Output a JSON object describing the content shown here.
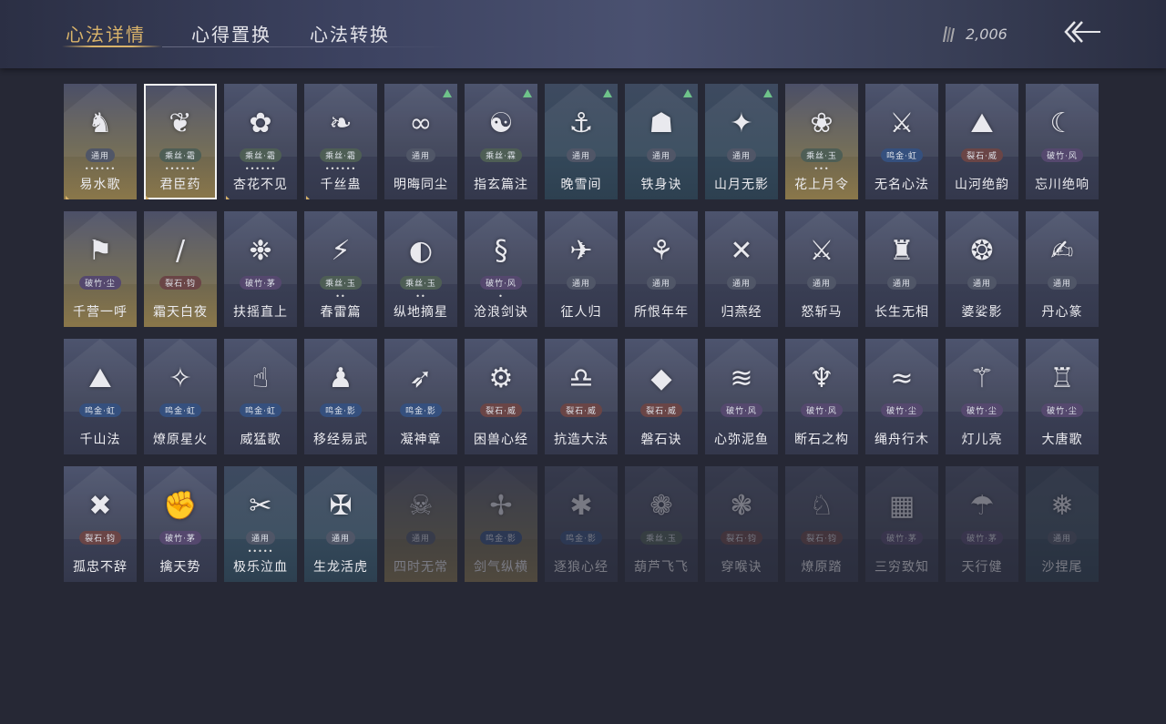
{
  "tabs": [
    {
      "label": "心法详情",
      "active": true
    },
    {
      "label": "心得置换",
      "active": false
    },
    {
      "label": "心法转换",
      "active": false
    }
  ],
  "currency": {
    "icon": "arrows-icon",
    "value": "2,006"
  },
  "back_icon": "back-arrow-icon",
  "cards": [
    {
      "name": "易水歌",
      "badge": "通用",
      "dots": "••••••",
      "icon": "♞",
      "bg": "gold",
      "badge_color": "gray",
      "corner": true
    },
    {
      "name": "君臣药",
      "badge": "乘丝·霜",
      "dots": "••••••",
      "icon": "❦",
      "bg": "gold",
      "badge_color": "green",
      "corner": true,
      "selected": true
    },
    {
      "name": "杏花不见",
      "badge": "乘丝·霜",
      "dots": "••••••",
      "icon": "✿",
      "bg": "",
      "badge_color": "green",
      "corner": true
    },
    {
      "name": "千丝蛊",
      "badge": "乘丝·霜",
      "dots": "••••••",
      "icon": "❧",
      "bg": "",
      "badge_color": "green",
      "corner": true
    },
    {
      "name": "明晦同尘",
      "badge": "通用",
      "icon": "∞",
      "bg": "",
      "badge_color": "gray",
      "arrow": true
    },
    {
      "name": "指玄篇注",
      "badge": "乘丝·霖",
      "icon": "☯",
      "bg": "",
      "badge_color": "green",
      "arrow": true
    },
    {
      "name": "晚雪间",
      "badge": "通用",
      "icon": "⚓",
      "bg": "blue",
      "badge_color": "gray",
      "arrow": true
    },
    {
      "name": "铁身诀",
      "badge": "通用",
      "icon": "☗",
      "bg": "blue",
      "badge_color": "gray",
      "arrow": true
    },
    {
      "name": "山月无影",
      "badge": "通用",
      "icon": "✦",
      "bg": "blue",
      "badge_color": "gray",
      "arrow": true
    },
    {
      "name": "花上月令",
      "badge": "乘丝·玉",
      "dots": "•••",
      "icon": "❀",
      "bg": "gold",
      "badge_color": "green"
    },
    {
      "name": "无名心法",
      "badge": "鸣金·虹",
      "icon": "⚔",
      "bg": "",
      "badge_color": "blue"
    },
    {
      "name": "山河绝韵",
      "badge": "裂石·威",
      "icon": "⛰",
      "bg": "",
      "badge_color": "red"
    },
    {
      "name": "忘川绝响",
      "badge": "破竹·风",
      "icon": "☾",
      "bg": "",
      "badge_color": "purple"
    },
    {
      "name": "千营一呼",
      "badge": "破竹·尘",
      "icon": "⚑",
      "bg": "gold",
      "badge_color": "purple"
    },
    {
      "name": "霜天白夜",
      "badge": "裂石·钧",
      "icon": "/",
      "bg": "gold",
      "badge_color": "red"
    },
    {
      "name": "扶摇直上",
      "badge": "破竹·茅",
      "icon": "❉",
      "bg": "",
      "badge_color": "purple"
    },
    {
      "name": "春雷篇",
      "badge": "乘丝·玉",
      "dots": "••",
      "icon": "⚡",
      "bg": "",
      "badge_color": "green"
    },
    {
      "name": "纵地摘星",
      "badge": "乘丝·玉",
      "dots": "••",
      "icon": "◐",
      "bg": "",
      "badge_color": "green"
    },
    {
      "name": "沧浪剑诀",
      "badge": "破竹·风",
      "dots": "•",
      "icon": "§",
      "bg": "",
      "badge_color": "purple"
    },
    {
      "name": "征人归",
      "badge": "通用",
      "icon": "✈",
      "bg": "",
      "badge_color": "gray"
    },
    {
      "name": "所恨年年",
      "badge": "通用",
      "icon": "⚘",
      "bg": "",
      "badge_color": "gray"
    },
    {
      "name": "归燕经",
      "badge": "通用",
      "icon": "✕",
      "bg": "",
      "badge_color": "gray"
    },
    {
      "name": "怒斩马",
      "badge": "通用",
      "icon": "⚔",
      "bg": "",
      "badge_color": "gray"
    },
    {
      "name": "长生无相",
      "badge": "通用",
      "icon": "♜",
      "bg": "",
      "badge_color": "gray"
    },
    {
      "name": "婆娑影",
      "badge": "通用",
      "icon": "❂",
      "bg": "",
      "badge_color": "gray"
    },
    {
      "name": "丹心篆",
      "badge": "通用",
      "icon": "✍",
      "bg": "",
      "badge_color": "gray"
    },
    {
      "name": "千山法",
      "badge": "鸣金·虹",
      "icon": "⛰",
      "bg": "",
      "badge_color": "blue"
    },
    {
      "name": "燎原星火",
      "badge": "鸣金·虹",
      "icon": "✧",
      "bg": "",
      "badge_color": "blue"
    },
    {
      "name": "威猛歌",
      "badge": "鸣金·虹",
      "icon": "☝",
      "bg": "",
      "badge_color": "blue"
    },
    {
      "name": "移经易武",
      "badge": "鸣金·影",
      "icon": "♟",
      "bg": "",
      "badge_color": "blue"
    },
    {
      "name": "凝神章",
      "badge": "鸣金·影",
      "icon": "➶",
      "bg": "",
      "badge_color": "blue"
    },
    {
      "name": "困兽心经",
      "badge": "裂石·威",
      "icon": "⚙",
      "bg": "",
      "badge_color": "red"
    },
    {
      "name": "抗造大法",
      "badge": "裂石·威",
      "icon": "♎",
      "bg": "",
      "badge_color": "red"
    },
    {
      "name": "磐石诀",
      "badge": "裂石·威",
      "icon": "◆",
      "bg": "",
      "badge_color": "red"
    },
    {
      "name": "心弥泥鱼",
      "badge": "破竹·风",
      "icon": "≋",
      "bg": "",
      "badge_color": "purple"
    },
    {
      "name": "断石之构",
      "badge": "破竹·风",
      "icon": "♆",
      "bg": "",
      "badge_color": "purple"
    },
    {
      "name": "绳舟行木",
      "badge": "破竹·尘",
      "icon": "≈",
      "bg": "",
      "badge_color": "purple"
    },
    {
      "name": "灯儿亮",
      "badge": "破竹·尘",
      "icon": "⚚",
      "bg": "",
      "badge_color": "purple"
    },
    {
      "name": "大唐歌",
      "badge": "破竹·尘",
      "icon": "♖",
      "bg": "",
      "badge_color": "purple"
    },
    {
      "name": "孤忠不辞",
      "badge": "裂石·钧",
      "icon": "✖",
      "bg": "",
      "badge_color": "red"
    },
    {
      "name": "擒天势",
      "badge": "破竹·茅",
      "icon": "✊",
      "bg": "",
      "badge_color": "purple"
    },
    {
      "name": "极乐泣血",
      "badge": "通用",
      "dots": "•••••",
      "icon": "✂",
      "bg": "blue",
      "badge_color": "gray"
    },
    {
      "name": "生龙活虎",
      "badge": "通用",
      "icon": "✠",
      "bg": "blue",
      "badge_color": "gray"
    },
    {
      "name": "四时无常",
      "badge": "通用",
      "icon": "☠",
      "bg": "gold",
      "badge_color": "gray",
      "dim": true
    },
    {
      "name": "剑气纵横",
      "badge": "鸣金·影",
      "icon": "✢",
      "bg": "gold",
      "badge_color": "blue",
      "dim": true
    },
    {
      "name": "逐狼心经",
      "badge": "鸣金·影",
      "icon": "✱",
      "bg": "",
      "badge_color": "blue",
      "dim": true
    },
    {
      "name": "葫芦飞飞",
      "badge": "乘丝·玉",
      "icon": "❁",
      "bg": "",
      "badge_color": "green",
      "dim": true
    },
    {
      "name": "穿喉诀",
      "badge": "裂石·钧",
      "icon": "❃",
      "bg": "",
      "badge_color": "red",
      "dim": true
    },
    {
      "name": "燎原踏",
      "badge": "裂石·钧",
      "icon": "♘",
      "bg": "",
      "badge_color": "red",
      "dim": true
    },
    {
      "name": "三穷致知",
      "badge": "破竹·茅",
      "icon": "▦",
      "bg": "",
      "badge_color": "purple",
      "dim": true
    },
    {
      "name": "天行健",
      "badge": "破竹·茅",
      "icon": "☂",
      "bg": "",
      "badge_color": "purple",
      "dim": true
    },
    {
      "name": "沙捏尾",
      "badge": "通用",
      "icon": "❅",
      "bg": "blue",
      "badge_color": "gray",
      "dim": true
    }
  ]
}
